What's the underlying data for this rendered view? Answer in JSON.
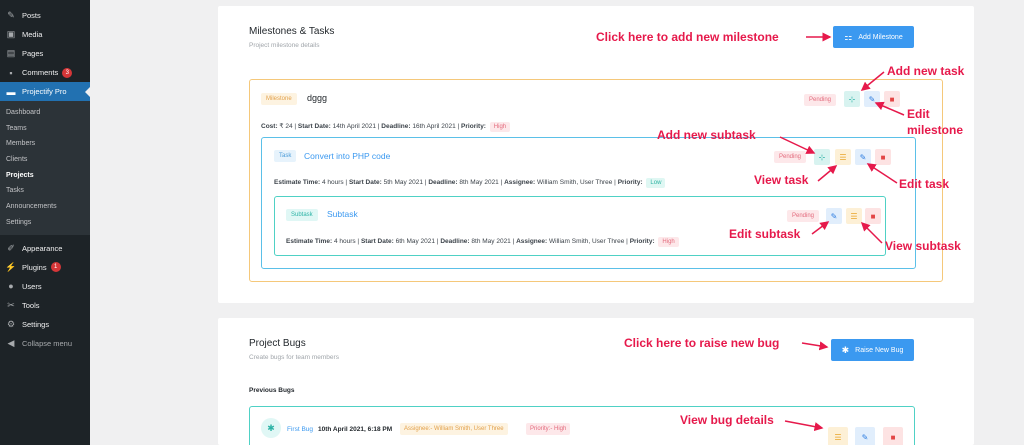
{
  "sidebar": {
    "top_items": [
      {
        "label": "Posts",
        "icon": "pin-icon"
      },
      {
        "label": "Media",
        "icon": "media-icon"
      },
      {
        "label": "Pages",
        "icon": "pages-icon"
      },
      {
        "label": "Comments",
        "icon": "comment-icon",
        "badge": "3"
      }
    ],
    "active": {
      "label": "Projectify Pro",
      "icon": "folder-icon"
    },
    "sub_items": [
      "Dashboard",
      "Teams",
      "Members",
      "Clients",
      "Projects",
      "Tasks",
      "Announcements",
      "Settings"
    ],
    "current_sub": "Projects",
    "bottom_items": [
      {
        "label": "Appearance",
        "icon": "brush-icon"
      },
      {
        "label": "Plugins",
        "icon": "plugin-icon",
        "badge": "1"
      },
      {
        "label": "Users",
        "icon": "users-icon"
      },
      {
        "label": "Tools",
        "icon": "wrench-icon"
      },
      {
        "label": "Settings",
        "icon": "settings-icon"
      },
      {
        "label": "Collapse menu",
        "icon": "collapse-icon"
      }
    ]
  },
  "milestones": {
    "title": "Milestones & Tasks",
    "subtitle": "Project milestone details",
    "add_button": "Add Milestone",
    "milestone": {
      "tag": "Milestone",
      "name": "dggg",
      "status": "Pending",
      "cost_label": "Cost:",
      "cost": "₹ 24",
      "start_label": "Start Date:",
      "start": "14th April 2021",
      "deadline_label": "Deadline:",
      "deadline": "16th April 2021",
      "priority_label": "Priority:",
      "priority": "High"
    },
    "task": {
      "tag": "Task",
      "name": "Convert into PHP code",
      "status": "Pending",
      "estimate_label": "Estimate Time:",
      "estimate": "4 hours",
      "start_label": "Start Date:",
      "start": "5th May 2021",
      "deadline_label": "Deadline:",
      "deadline": "8th May 2021",
      "assignee_label": "Assignee:",
      "assignee": "William Smith, User Three",
      "priority_label": "Priority:",
      "priority": "Low"
    },
    "subtask": {
      "tag": "Subtask",
      "name": "Subtask",
      "status": "Pending",
      "estimate_label": "Estimate Time:",
      "estimate": "4 hours",
      "start_label": "Start Date:",
      "start": "6th May 2021",
      "deadline_label": "Deadline:",
      "deadline": "8th May 2021",
      "assignee_label": "Assignee:",
      "assignee": "William Smith, User Three",
      "priority_label": "Priority:",
      "priority": "High"
    }
  },
  "bugs": {
    "title": "Project Bugs",
    "subtitle": "Create bugs for team members",
    "raise_button": "Raise New Bug",
    "previous_label": "Previous Bugs",
    "bug": {
      "name": "First Bug",
      "date": "10th April 2021, 6:18 PM",
      "assignee": "Assignee:- William Smith, User Three",
      "priority": "Priority:- High"
    }
  },
  "annotations": {
    "add_milestone": "Click here to add new milestone",
    "add_task": "Add new task",
    "edit_milestone_1": "Edit",
    "edit_milestone_2": "milestone",
    "add_subtask": "Add new subtask",
    "view_task": "View task",
    "edit_task": "Edit task",
    "edit_subtask": "Edit subtask",
    "view_subtask": "View subtask",
    "raise_bug": "Click here to raise new bug",
    "view_bug": "View bug details"
  },
  "colors": {
    "accent_blue": "#3b99f0",
    "annotation": "#e6194b",
    "milestone_border": "#f5c87a",
    "task_border": "#5bc0e8",
    "subtask_border": "#4fd1c5"
  }
}
